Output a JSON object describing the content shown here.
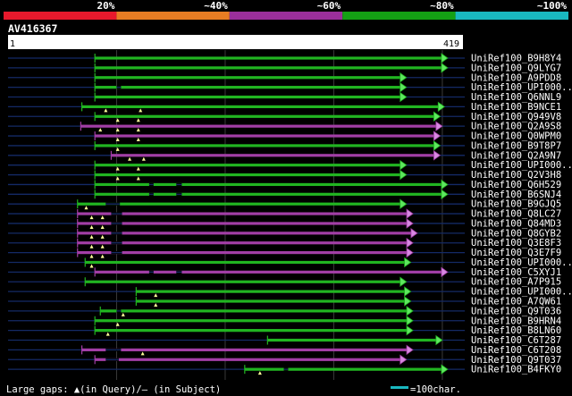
{
  "identity_legend": [
    {
      "label": "20%",
      "color": "#e8192c"
    },
    {
      "label": "~40%",
      "color": "#e87d23"
    },
    {
      "label": "~60%",
      "color": "#9b2f9b"
    },
    {
      "label": "~80%",
      "color": "#14a014"
    },
    {
      "label": "~100%",
      "color": "#19b8c0"
    }
  ],
  "query": {
    "name": "AV416367",
    "start": "1",
    "end": "419",
    "length": 419
  },
  "colors": {
    "green": "#21b521",
    "magenta": "#a23ea6",
    "green_head": "#5fe75f",
    "magenta_head": "#d889e2",
    "gap": "#ffff99",
    "line": "#142a66",
    "grid": "#3a3a3a"
  },
  "hits": [
    {
      "name": "UniRef100_B9H8Y4",
      "color": "green",
      "start": 80,
      "end": 400,
      "gaps_q": [],
      "thin": []
    },
    {
      "name": "UniRef100_Q9LYG7",
      "color": "green",
      "start": 80,
      "end": 400,
      "gaps_q": [],
      "thin": []
    },
    {
      "name": "UniRef100_A9PDD8",
      "color": "green",
      "start": 80,
      "end": 362,
      "gaps_q": [],
      "thin": []
    },
    {
      "name": "UniRef100_UPI000...",
      "color": "green",
      "start": 80,
      "end": 362,
      "gaps_q": [],
      "thin": [
        [
          100,
          104
        ]
      ]
    },
    {
      "name": "UniRef100_Q6NNL9",
      "color": "green",
      "start": 80,
      "end": 362,
      "gaps_q": [],
      "thin": []
    },
    {
      "name": "UniRef100_B9NCE1",
      "color": "green",
      "start": 68,
      "end": 397,
      "gaps_q": [
        90,
        122
      ],
      "thin": []
    },
    {
      "name": "UniRef100_Q949V8",
      "color": "green",
      "start": 80,
      "end": 393,
      "gaps_q": [
        101,
        120
      ],
      "thin": []
    },
    {
      "name": "UniRef100_Q2A9S8",
      "color": "magenta",
      "start": 67,
      "end": 395,
      "gaps_q": [
        85,
        101,
        120
      ],
      "thin": []
    },
    {
      "name": "UniRef100_Q0WPM0",
      "color": "magenta",
      "start": 80,
      "end": 393,
      "gaps_q": [
        101,
        120
      ],
      "thin": []
    },
    {
      "name": "UniRef100_B9T8P7",
      "color": "green",
      "start": 80,
      "end": 393,
      "gaps_q": [
        101
      ],
      "thin": []
    },
    {
      "name": "UniRef100_Q2A9N7",
      "color": "magenta",
      "start": 95,
      "end": 393,
      "gaps_q": [
        112,
        125
      ],
      "thin": []
    },
    {
      "name": "UniRef100_UPI000...",
      "color": "green",
      "start": 80,
      "end": 362,
      "gaps_q": [
        101,
        120
      ],
      "thin": []
    },
    {
      "name": "UniRef100_Q2V3H8",
      "color": "green",
      "start": 80,
      "end": 362,
      "gaps_q": [
        101,
        120
      ],
      "thin": []
    },
    {
      "name": "UniRef100_Q6H529",
      "color": "green",
      "start": 80,
      "end": 400,
      "gaps_q": [],
      "thin": [
        [
          130,
          134
        ],
        [
          155,
          160
        ]
      ]
    },
    {
      "name": "UniRef100_B6SNJ4",
      "color": "green",
      "start": 80,
      "end": 400,
      "gaps_q": [],
      "thin": [
        [
          130,
          134
        ],
        [
          155,
          160
        ]
      ]
    },
    {
      "name": "UniRef100_B9GJQ5",
      "color": "green",
      "start": 64,
      "end": 362,
      "gaps_q": [
        72
      ],
      "thin": [
        [
          90,
          103
        ]
      ]
    },
    {
      "name": "UniRef100_Q8LC27",
      "color": "magenta",
      "start": 64,
      "end": 368,
      "gaps_q": [
        77,
        87
      ],
      "thin": [
        [
          95,
          105
        ]
      ]
    },
    {
      "name": "UniRef100_Q84MD3",
      "color": "magenta",
      "start": 64,
      "end": 368,
      "gaps_q": [
        77,
        87
      ],
      "thin": [
        [
          95,
          105
        ]
      ]
    },
    {
      "name": "UniRef100_Q8GYB2",
      "color": "magenta",
      "start": 64,
      "end": 372,
      "gaps_q": [
        77,
        87
      ],
      "thin": [
        [
          95,
          105
        ]
      ]
    },
    {
      "name": "UniRef100_Q3E8F3",
      "color": "magenta",
      "start": 64,
      "end": 368,
      "gaps_q": [
        77,
        87
      ],
      "thin": [
        [
          95,
          105
        ]
      ]
    },
    {
      "name": "UniRef100_Q3E7F9",
      "color": "magenta",
      "start": 64,
      "end": 368,
      "gaps_q": [
        77,
        87
      ],
      "thin": [
        [
          95,
          105
        ]
      ]
    },
    {
      "name": "UniRef100_UPI000...",
      "color": "green",
      "start": 71,
      "end": 366,
      "gaps_q": [
        77
      ],
      "thin": []
    },
    {
      "name": "UniRef100_C5XYJ1",
      "color": "magenta",
      "start": 80,
      "end": 400,
      "gaps_q": [],
      "thin": [
        [
          130,
          134
        ],
        [
          155,
          160
        ]
      ]
    },
    {
      "name": "UniRef100_A7P915",
      "color": "green",
      "start": 71,
      "end": 362,
      "gaps_q": [],
      "thin": []
    },
    {
      "name": "UniRef100_UPI000...",
      "color": "green",
      "start": 118,
      "end": 366,
      "gaps_q": [
        136
      ],
      "thin": []
    },
    {
      "name": "UniRef100_A7QW61",
      "color": "green",
      "start": 118,
      "end": 366,
      "gaps_q": [
        136
      ],
      "thin": []
    },
    {
      "name": "UniRef100_Q9T036",
      "color": "green",
      "start": 85,
      "end": 368,
      "gaps_q": [
        106
      ],
      "thin": [
        [
          100,
          104
        ]
      ]
    },
    {
      "name": "UniRef100_B9HRN4",
      "color": "green",
      "start": 80,
      "end": 368,
      "gaps_q": [
        101
      ],
      "thin": []
    },
    {
      "name": "UniRef100_B8LN60",
      "color": "green",
      "start": 80,
      "end": 368,
      "gaps_q": [
        92
      ],
      "thin": []
    },
    {
      "name": "UniRef100_C6T287",
      "color": "green",
      "start": 239,
      "end": 395,
      "gaps_q": [],
      "thin": []
    },
    {
      "name": "UniRef100_C6T208",
      "color": "magenta",
      "start": 68,
      "end": 368,
      "gaps_q": [
        124
      ],
      "thin": [
        [
          90,
          104
        ]
      ]
    },
    {
      "name": "UniRef100_Q9T037",
      "color": "magenta",
      "start": 80,
      "end": 362,
      "gaps_q": [],
      "thin": [
        [
          90,
          102
        ]
      ]
    },
    {
      "name": "UniRef100_B4FKY0",
      "color": "green",
      "start": 218,
      "end": 400,
      "gaps_q": [
        232
      ],
      "thin": [
        [
          254,
          258
        ]
      ]
    }
  ],
  "footer": {
    "gaps_text": "Large gaps: ▲(in Query)/– (in Subject)",
    "scale_text": "=100char.",
    "scale_color": "#19b8c0"
  }
}
